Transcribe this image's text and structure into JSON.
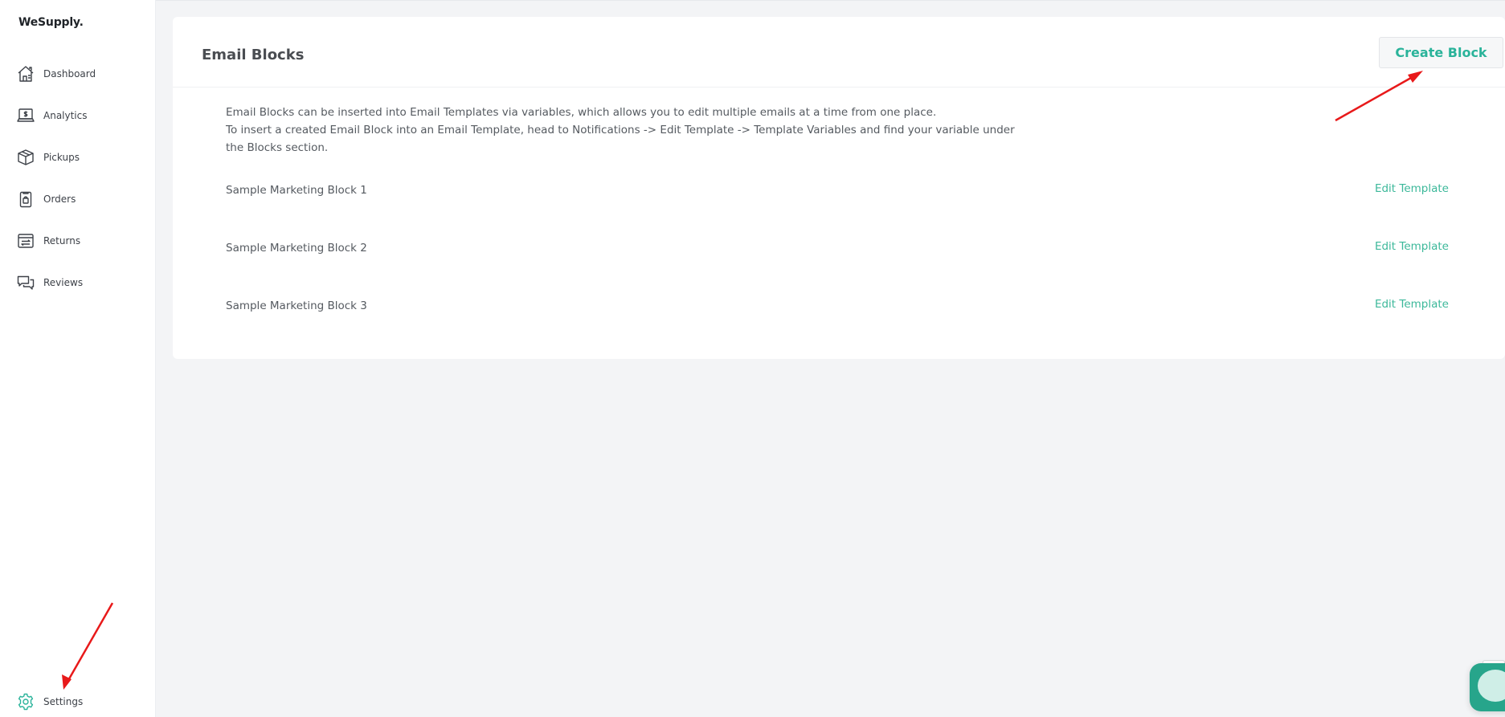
{
  "brand": {
    "name": "WeSupply."
  },
  "sidebar": {
    "items": [
      {
        "label": "Dashboard",
        "icon": "house-icon"
      },
      {
        "label": "Analytics",
        "icon": "laptop-dollar-icon"
      },
      {
        "label": "Pickups",
        "icon": "box-icon"
      },
      {
        "label": "Orders",
        "icon": "clipboard-bag-icon"
      },
      {
        "label": "Returns",
        "icon": "return-arrows-icon"
      },
      {
        "label": "Reviews",
        "icon": "chat-bubbles-icon"
      }
    ],
    "settings": {
      "label": "Settings",
      "icon": "gear-icon"
    }
  },
  "main": {
    "title": "Email Blocks",
    "create_button": "Create Block",
    "description": [
      "Email Blocks can be inserted into Email Templates via variables, which allows you to edit multiple emails at a time from one place.",
      "To insert a created Email Block into an Email Template, head to Notifications -> Edit Template -> Template Variables and find your variable under",
      "the Blocks section."
    ],
    "blocks": [
      {
        "name": "Sample Marketing Block 1",
        "action": "Edit Template"
      },
      {
        "name": "Sample Marketing Block 2",
        "action": "Edit Template"
      },
      {
        "name": "Sample Marketing Block 3",
        "action": "Edit Template"
      }
    ]
  },
  "colors": {
    "accent": "#2ab39a",
    "annotation": "#e8191a",
    "background": "#f3f4f6",
    "card": "#ffffff"
  },
  "chat_widget": {
    "icon": "chat-icon"
  }
}
